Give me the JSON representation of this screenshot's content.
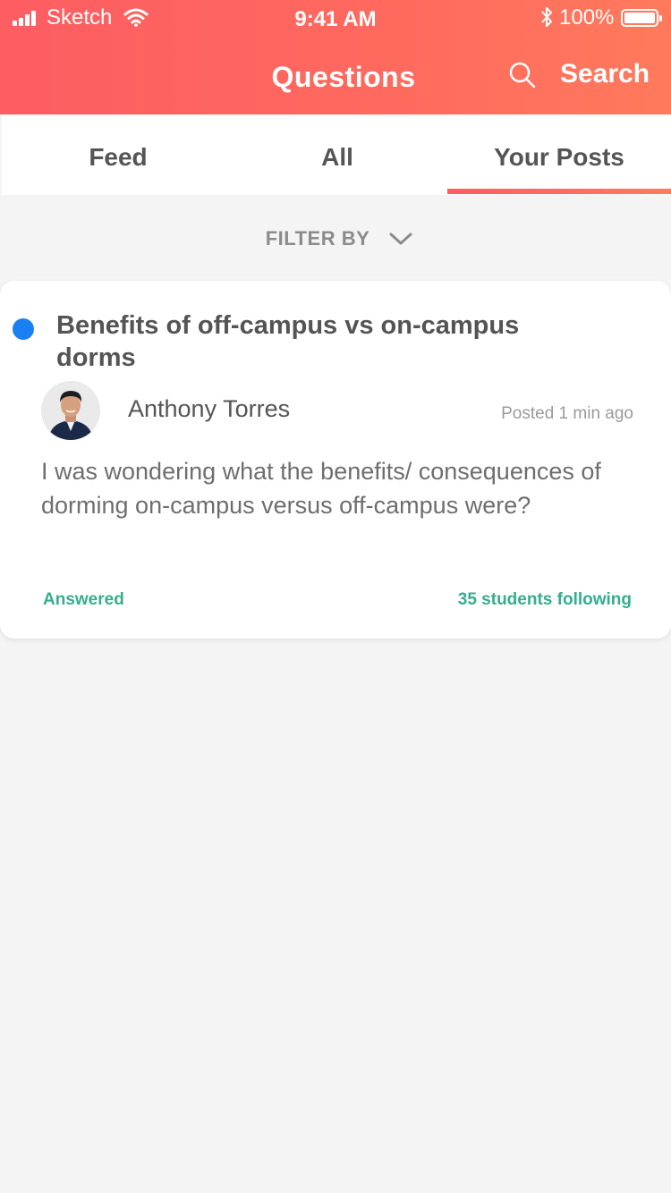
{
  "status_bar": {
    "carrier": "Sketch",
    "time": "9:41 AM",
    "battery": "100%"
  },
  "header": {
    "title": "Questions",
    "search_label": "Search"
  },
  "tabs": [
    {
      "label": "Feed"
    },
    {
      "label": "All"
    },
    {
      "label": "Your Posts",
      "active": true
    }
  ],
  "filter": {
    "label": "FILTER BY"
  },
  "post": {
    "title": "Benefits of off-campus vs on-campus dorms",
    "author": "Anthony Torres",
    "posted": "Posted 1 min ago",
    "body": "I was wondering what the benefits/ consequences of dorming on-campus versus off-campus were?",
    "status": "Answered",
    "followers": "35 students following"
  },
  "colors": {
    "brand": "#fe5d62",
    "accent_green": "#35ad8f",
    "unread_dot": "#1a7ff0"
  },
  "icons": [
    "signal-icon",
    "wifi-icon",
    "bluetooth-icon",
    "battery-icon",
    "search-icon",
    "chevron-down-icon",
    "avatar"
  ]
}
